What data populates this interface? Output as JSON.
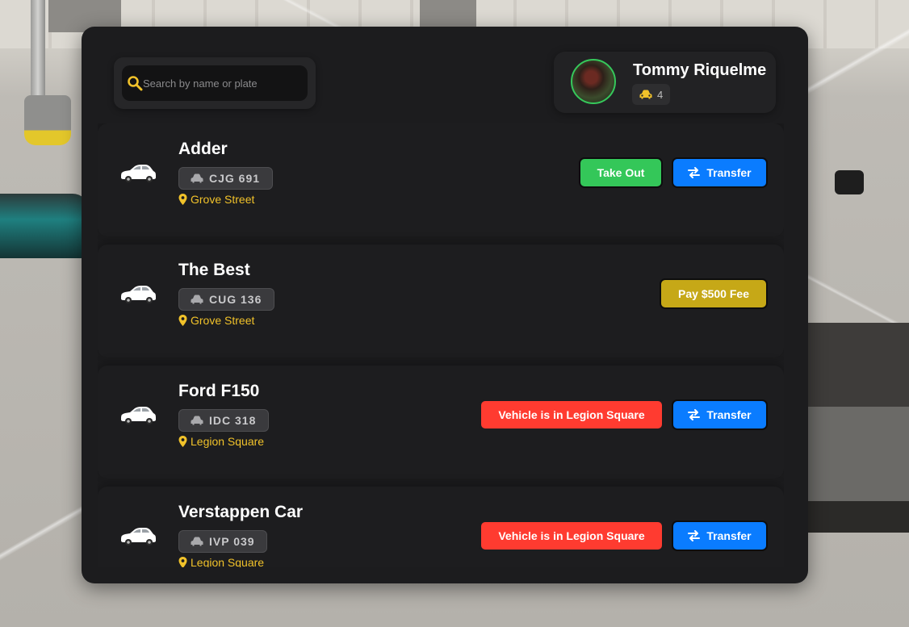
{
  "search": {
    "placeholder": "Search by name or plate"
  },
  "profile": {
    "name": "Tommy Riquelme",
    "vehicle_count": "4"
  },
  "vehicles": [
    {
      "name": "Adder",
      "plate": "CJG 691",
      "location": "Grove Street",
      "actions": [
        "Take Out",
        "Transfer"
      ]
    },
    {
      "name": "The Best",
      "plate": "CUG 136",
      "location": "Grove Street",
      "actions": [
        "Pay $500 Fee"
      ]
    },
    {
      "name": "Ford F150",
      "plate": "IDC 318",
      "location": "Legion Square",
      "actions": [
        "Vehicle is in Legion Square",
        "Transfer"
      ]
    },
    {
      "name": "Verstappen Car",
      "plate": "IVP 039",
      "location": "Legion Square",
      "actions": [
        "Vehicle is in Legion Square",
        "Transfer"
      ]
    }
  ],
  "colors": {
    "panel": "#1c1c1e",
    "take_out": "#34c759",
    "transfer": "#0a7cff",
    "fee": "#c6a817",
    "location_status": "#ff3b30",
    "location_text": "#f1c22a",
    "avatar_ring": "#36c85b"
  },
  "icons": {
    "search": "search-icon",
    "car": "car-icon",
    "pin": "map-pin-icon",
    "transfer": "transfer-arrows-icon"
  }
}
